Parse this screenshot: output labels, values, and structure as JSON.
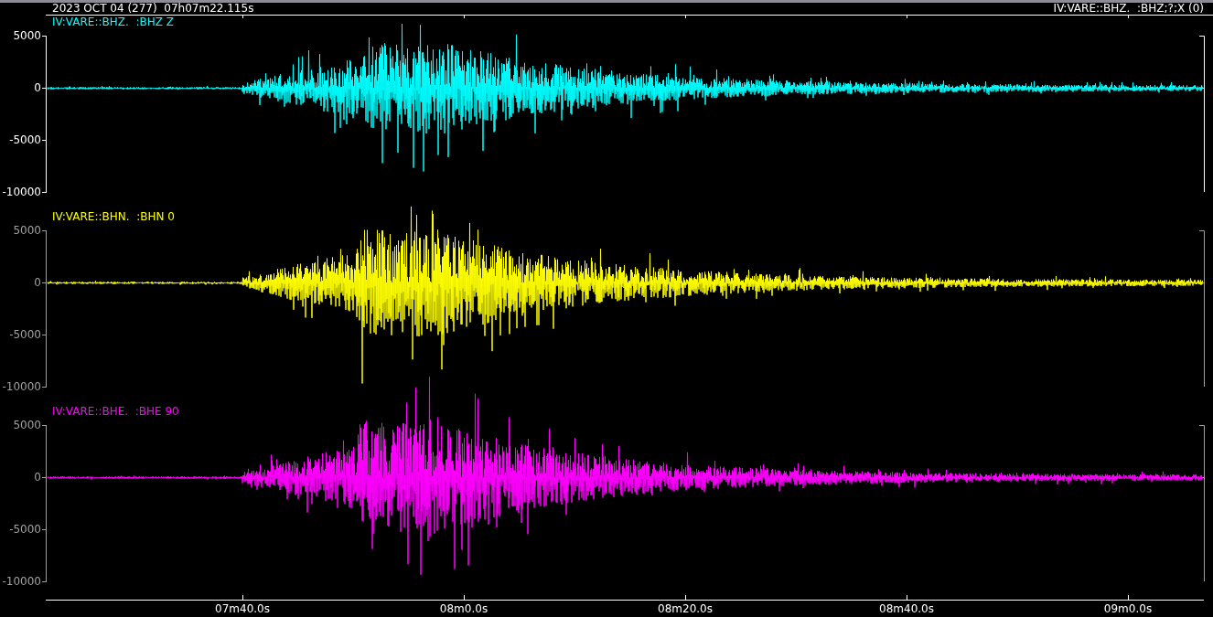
{
  "header": {
    "start_time": "2023 OCT 04 (277)  07h07m22.115s",
    "trace_id": "IV:VARE::BHZ.  :BHZ;?;X (0)"
  },
  "traces": [
    {
      "label": "IV:VARE::BHZ.  :BHZ Z",
      "color": "#00ffff",
      "selected": true,
      "y_ticks": [
        "5000",
        "0",
        "-5000",
        "-10000"
      ]
    },
    {
      "label": "IV:VARE::BHN.  :BHN 0",
      "color": "#ffff00",
      "selected": false,
      "y_ticks": [
        "5000",
        "0",
        "-5000",
        "-10000"
      ]
    },
    {
      "label": "IV:VARE::BHE.  :BHE 90",
      "color": "#ff00ff",
      "selected": false,
      "y_ticks": [
        "5000",
        "0",
        "-5000",
        "-10000"
      ]
    }
  ],
  "time_axis": {
    "ticks": [
      "07m40.0s",
      "08m0.0s",
      "08m20.0s",
      "08m40.0s",
      "09m0.0s"
    ]
  }
}
